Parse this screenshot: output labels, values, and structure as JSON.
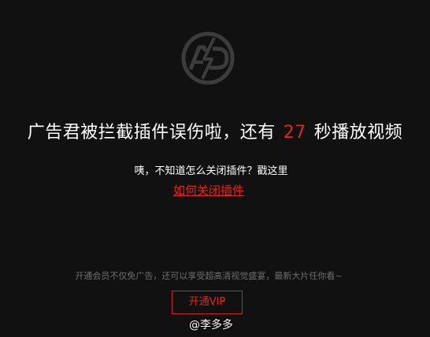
{
  "player": {
    "background": "#111111",
    "accent_color": "#e0261a"
  },
  "logo": {
    "icon": "adblock-logo-icon",
    "text": "AD"
  },
  "message": {
    "prefix": "广告君被拦截插件误伤啦，还有",
    "countdown": "27",
    "suffix": "秒播放视频"
  },
  "hint": {
    "text": "咦，不知道怎么关闭插件？戳这里"
  },
  "link": {
    "label": "如何关闭插件"
  },
  "promo": {
    "text": "开通会员不仅免广告，还可以享受超高清视觉盛宴，最新大片任你看~"
  },
  "vip_button": {
    "label": "开通VIP"
  },
  "watermark": {
    "text": "@李多多"
  }
}
